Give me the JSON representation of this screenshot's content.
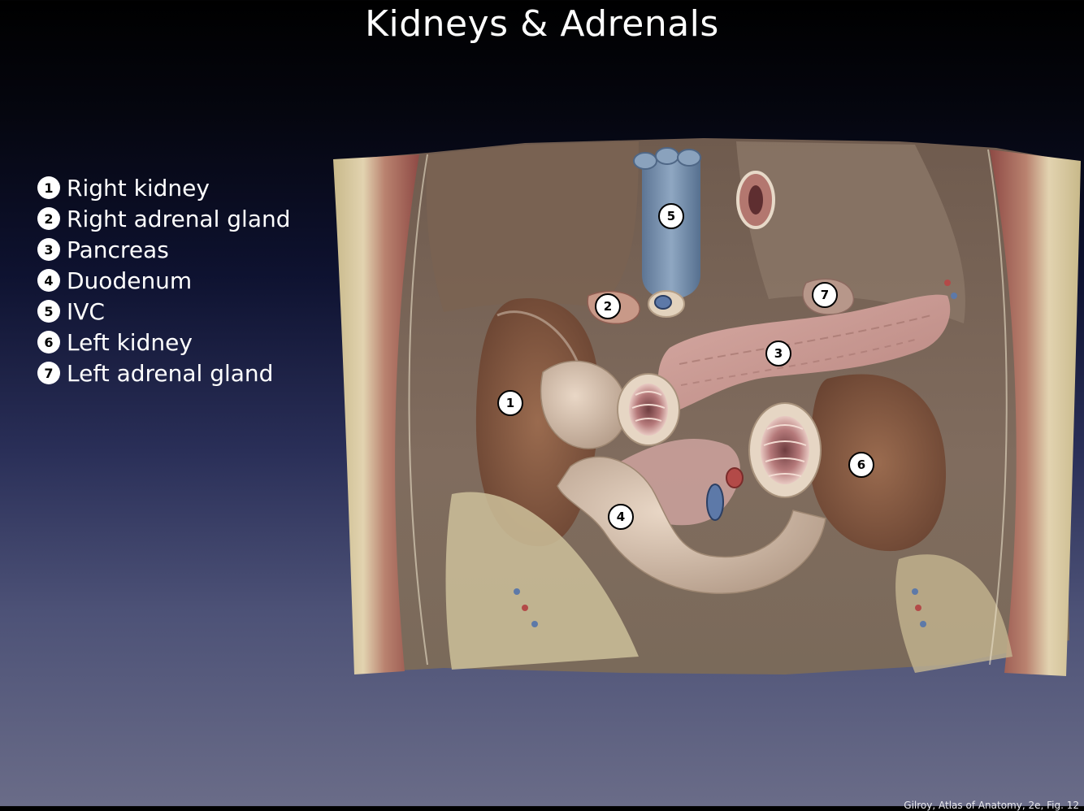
{
  "slide": {
    "title": "Kidneys & Adrenals",
    "citation": "Gilroy, Atlas of Anatomy, 2e, Fig. 12"
  },
  "legend": [
    {
      "number": "1",
      "label": "Right kidney"
    },
    {
      "number": "2",
      "label": "Right adrenal gland"
    },
    {
      "number": "3",
      "label": "Pancreas"
    },
    {
      "number": "4",
      "label": "Duodenum"
    },
    {
      "number": "5",
      "label": "IVC"
    },
    {
      "number": "6",
      "label": "Left kidney"
    },
    {
      "number": "7",
      "label": "Left adrenal gland"
    }
  ],
  "markers": [
    "1",
    "2",
    "3",
    "4",
    "5",
    "6",
    "7"
  ]
}
